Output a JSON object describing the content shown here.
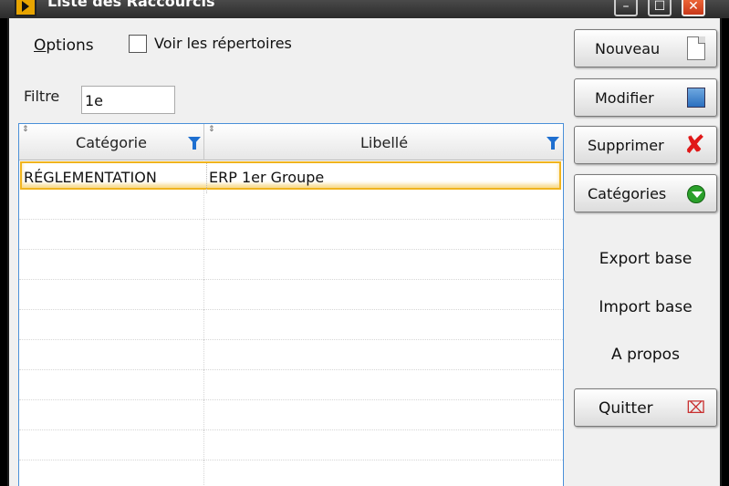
{
  "window": {
    "title": "Liste des Raccourcis",
    "controls": {
      "minimize": "–",
      "maximize": "☐",
      "close": "✕"
    }
  },
  "options": {
    "label_prefix": "O",
    "label_rest": "ptions",
    "show_dirs_label": "Voir les répertoires",
    "show_dirs_checked": false
  },
  "filter": {
    "label": "Filtre",
    "value": "1e"
  },
  "grid": {
    "columns": [
      "Catégorie",
      "Libellé"
    ],
    "rows": [
      {
        "categorie": "RÉGLEMENTATION",
        "libelle": "ERP 1er Groupe",
        "selected": true
      }
    ]
  },
  "actions": {
    "nouveau": "Nouveau",
    "modifier": "Modifier",
    "supprimer": "Supprimer",
    "categories": "Catégories",
    "export": "Export base",
    "import": "Import base",
    "apropos": "A propos",
    "quitter": "Quitter"
  },
  "icons": {
    "nouveau": "new-document-icon",
    "modifier": "edit-image-icon",
    "supprimer": "red-x-icon",
    "categories": "green-down-arrow-icon",
    "quitter": "close-x-icon"
  },
  "colors": {
    "selection_border": "#f0b41e",
    "grid_border": "#4a90d9",
    "filter_icon": "#1e6fd0"
  }
}
